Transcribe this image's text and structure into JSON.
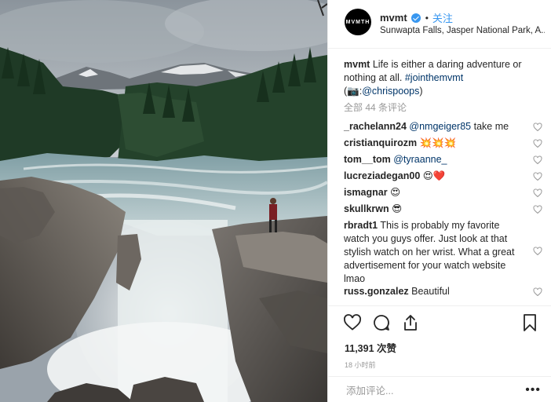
{
  "header": {
    "avatar_text": "MVMTH",
    "username": "mvmt",
    "dot": "•",
    "follow_label": "关注",
    "location": "Sunwapta Falls, Jasper National Park, A..."
  },
  "caption": {
    "username": "mvmt",
    "text_1": " Life is either a daring adventure or nothing at all. ",
    "hashtag": "#jointhemvmt",
    "line2_prefix": "(📷:",
    "mention": "@chrispoops",
    "line2_suffix": ")"
  },
  "all_comments_label": "全部 44 条评论",
  "comments": [
    {
      "user": "_rachelann24",
      "mention": "@nmgeiger85",
      "text": " take me"
    },
    {
      "user": "cristianquirozm",
      "mention": "",
      "text": " 💥💥💥"
    },
    {
      "user": "tom__tom",
      "mention": "@tyraanne_",
      "text": ""
    },
    {
      "user": "lucreziadegan00",
      "mention": "",
      "text": " 😍❤️"
    },
    {
      "user": "ismagnar",
      "mention": "",
      "text": " 😍"
    },
    {
      "user": "skullkrwn",
      "mention": "",
      "text": " 😎"
    },
    {
      "user": "rbradt1",
      "mention": "",
      "text": " This is probably my favorite watch you guys offer. Just look at that stylish watch on her wrist. What a great advertisement for your watch website lmao"
    },
    {
      "user": "russ.gonzalez",
      "mention": "",
      "text": " Beautiful"
    }
  ],
  "actions": {
    "like_icon": "heart-icon",
    "comment_icon": "comment-icon",
    "share_icon": "share-icon",
    "save_icon": "bookmark-icon"
  },
  "likes_label": "11,391 次赞",
  "time_label": "18 小时前",
  "add_comment_placeholder": "添加评论...",
  "more_label": "•••",
  "colors": {
    "link": "#003569",
    "accent": "#3897f0",
    "muted": "#999999"
  }
}
